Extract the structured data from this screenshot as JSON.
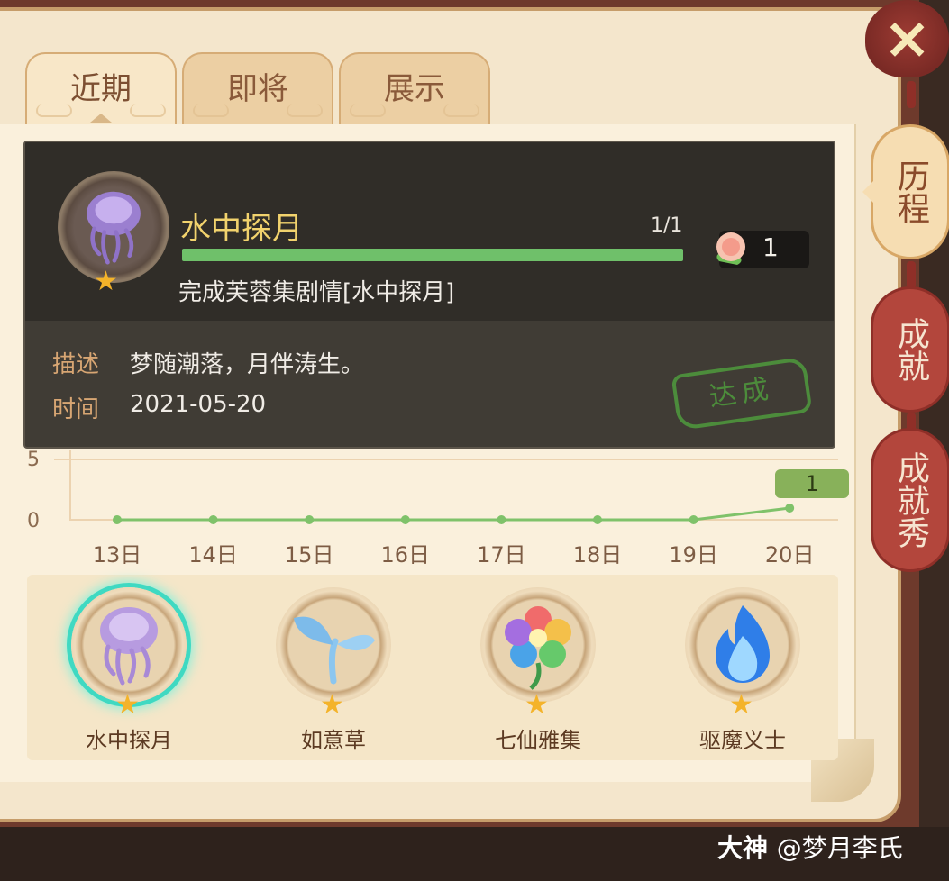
{
  "tabs": [
    {
      "label": "近期",
      "active": true
    },
    {
      "label": "即将",
      "active": false
    },
    {
      "label": "展示",
      "active": false
    }
  ],
  "side_tabs": [
    {
      "label": "历程",
      "active": true
    },
    {
      "label": "成就",
      "active": false
    },
    {
      "label": "成就秀",
      "active": false
    }
  ],
  "close_icon": "×",
  "popup": {
    "title": "水中探月",
    "progress_text": "1/1",
    "progress_fraction": 1.0,
    "requirement": "完成芙蓉集剧情[水中探月]",
    "reward_icon": "peach-icon",
    "reward_count": "1",
    "desc_label": "描述",
    "desc_value": "梦随潮落，月伴涛生。",
    "time_label": "时间",
    "time_value": "2021-05-20",
    "stamp": "达成"
  },
  "chart_data": {
    "type": "line",
    "categories": [
      "13日",
      "14日",
      "15日",
      "16日",
      "17日",
      "18日",
      "19日",
      "20日"
    ],
    "values": [
      0,
      0,
      0,
      0,
      0,
      0,
      0,
      1
    ],
    "y_tick_labels": [
      "0",
      "5"
    ],
    "last_value_label": "1",
    "line_color": "#7fc26a"
  },
  "achievements": [
    {
      "name": "水中探月",
      "icon": "jellyfish-icon",
      "selected": true
    },
    {
      "name": "如意草",
      "icon": "sprout-icon",
      "selected": false
    },
    {
      "name": "七仙雅集",
      "icon": "rainbow-flower-icon",
      "selected": false
    },
    {
      "name": "驱魔义士",
      "icon": "blue-flame-icon",
      "selected": false
    }
  ],
  "watermark": {
    "brand": "大神",
    "handle": "@梦月李氏"
  }
}
